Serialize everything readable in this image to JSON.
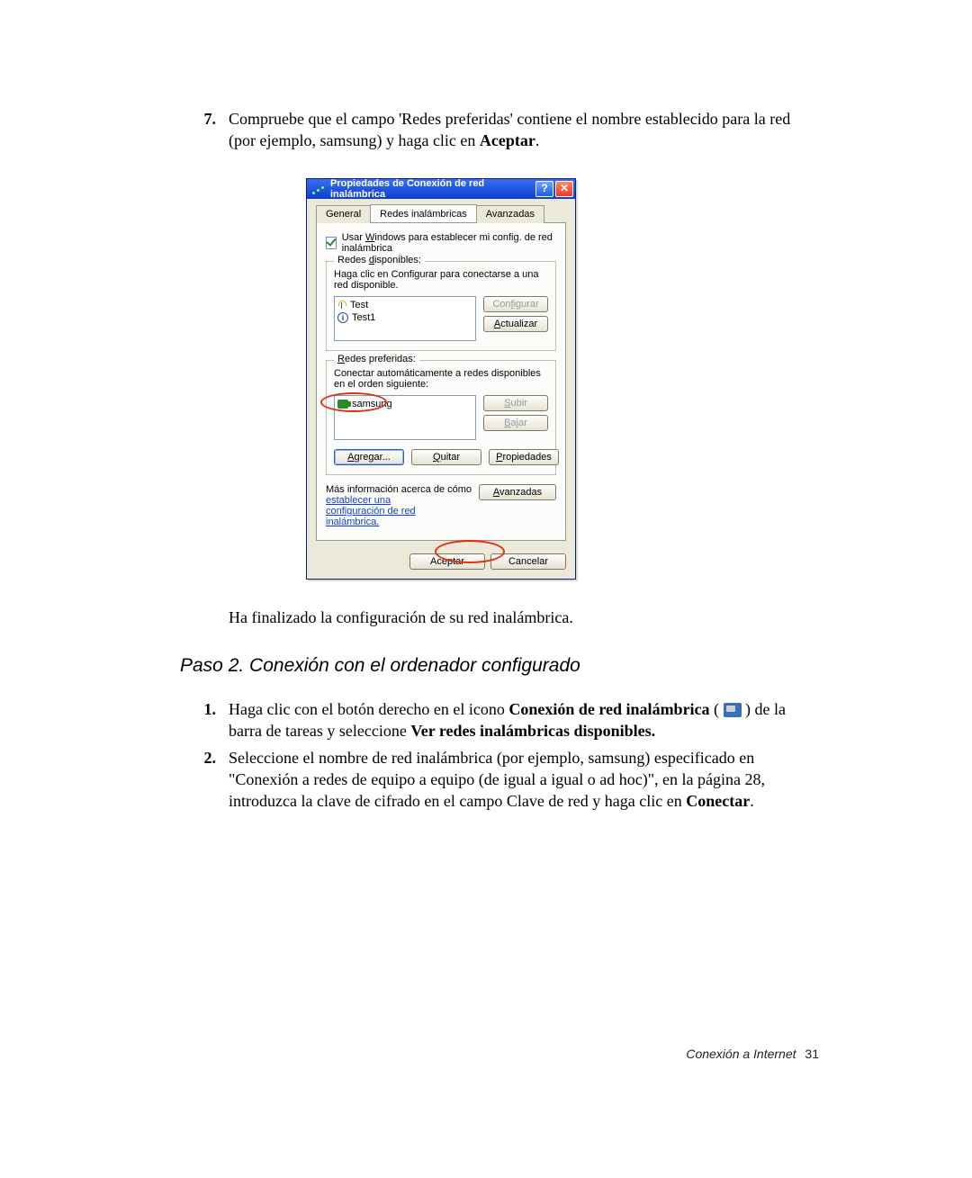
{
  "step7": {
    "num": "7.",
    "text_before": "Compruebe que el campo 'Redes preferidas' contiene el nombre establecido para la red (por ejemplo, samsung) y haga clic en ",
    "bold": "Aceptar",
    "period": "."
  },
  "dialog": {
    "title": "Propiedades de Conexión de red inalámbrica",
    "help_btn": "?",
    "close_btn": "✕",
    "tabs": {
      "general": "General",
      "wireless": "Redes inalámbricas",
      "advanced": "Avanzadas"
    },
    "checkbox_label_pre": "Usar ",
    "checkbox_label_u": "W",
    "checkbox_label_post": "indows para establecer mi config. de red inalámbrica",
    "available": {
      "legend_pre": "Redes ",
      "legend_u": "d",
      "legend_post": "isponibles:",
      "help": "Haga clic en Configurar para conectarse a una red disponible.",
      "items": [
        {
          "icon": "antenna",
          "label": "Test"
        },
        {
          "icon": "info",
          "label": "Test1"
        }
      ],
      "btn_configure": "Configurar",
      "btn_refresh_u": "A",
      "btn_refresh_post": "ctualizar"
    },
    "preferred": {
      "legend_u": "R",
      "legend_post": "edes preferidas:",
      "help": "Conectar automáticamente a redes disponibles en el orden siguiente:",
      "items": [
        {
          "icon": "card",
          "label": "samsung"
        }
      ],
      "btn_up_u": "S",
      "btn_up_post": "ubir",
      "btn_down_u": "B",
      "btn_down_post": "ajar",
      "btn_add_u": "A",
      "btn_add_post": "gregar...",
      "btn_remove_u": "Q",
      "btn_remove_post": "uitar",
      "btn_props_u": "P",
      "btn_props_post": "ropiedades"
    },
    "more_info_pre": "Más información acerca de cómo ",
    "more_info_link1": "establecer una",
    "more_info_link2": "configuración de red inalámbrica.",
    "btn_advanced_u": "A",
    "btn_advanced_post": "vanzadas",
    "btn_ok": "Aceptar",
    "btn_cancel": "Cancelar"
  },
  "after_dialog": "Ha finalizado la configuración de su red inalámbrica.",
  "section2": "Paso 2. Conexión con el ordenador configurado",
  "step1b": {
    "num": "1.",
    "t1": "Haga clic con el botón derecho en el icono ",
    "b1": "Conexión de red inalámbrica",
    "t2": " ( ",
    "t3": " ) de la barra de tareas y seleccione ",
    "b2": "Ver redes inalámbricas disponibles."
  },
  "step2b": {
    "num": "2.",
    "t1": "Seleccione el nombre de red inalámbrica (por ejemplo, samsung) especificado en \"Conexión a redes de equipo a equipo (de igual a igual o ad hoc)\", en la página 28, introduzca la clave de cifrado en el campo Clave de red y haga clic en ",
    "b1": "Conectar",
    "t2": "."
  },
  "footer": {
    "label": "Conexión a Internet",
    "page": "31"
  }
}
